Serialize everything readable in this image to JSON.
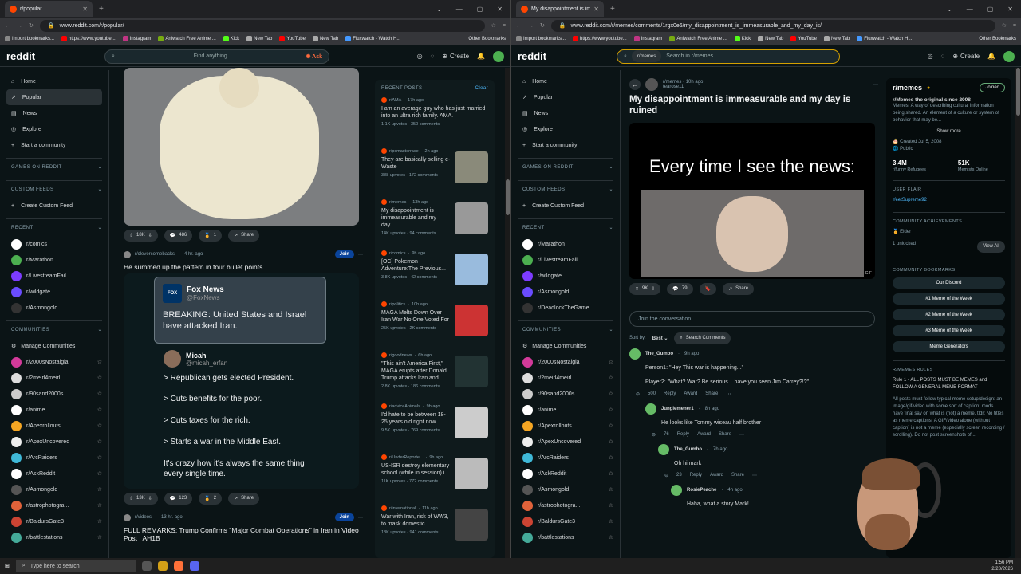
{
  "left": {
    "tab_title": "r/popular",
    "url": "www.reddit.com/r/popular/",
    "bookmarks": [
      "Import bookmarks...",
      "https://www.youtube...",
      "Instagram",
      "Aniwatch Free Anime ...",
      "Kick",
      "New Tab",
      "YouTube",
      "New Tab",
      "Fluxwatch - Watch H..."
    ],
    "other_bookmarks": "Other Bookmarks",
    "search_placeholder": "Find anything",
    "ask": "Ask",
    "create": "Create",
    "nav": [
      "Home",
      "Popular",
      "News",
      "Explore",
      "Start a community"
    ],
    "sec_games": "GAMES ON REDDIT",
    "sec_custom": "CUSTOM FEEDS",
    "create_feed": "Create Custom Feed",
    "sec_recent": "RECENT",
    "recent": [
      "r/comics",
      "r/Marathon",
      "r/LivestreamFail",
      "r/wildgate",
      "r/Asmongold"
    ],
    "sec_comm": "COMMUNITIES",
    "manage": "Manage Communities",
    "communities": [
      "r/2000sNostalgia",
      "r/2meirl4meirl",
      "r/90sand2000s...",
      "r/anime",
      "r/Apexrollouts",
      "r/ApexUncovered",
      "r/ArcRaiders",
      "r/AskReddit",
      "r/Asmongold",
      "r/astrophotogra...",
      "r/BaldursGate3",
      "r/battlestations"
    ],
    "post1": {
      "upvotes": "18K",
      "comments": "486",
      "awards": "1",
      "share": "Share"
    },
    "post2": {
      "sub": "r/clevercomebacks",
      "time": "4 hr. ago",
      "join": "Join",
      "title": "He summed up the pattern in four bullet points.",
      "fox_name": "Fox News",
      "fox_handle": "@FoxNews",
      "fox_text": "BREAKING: United States and Israel have attacked Iran.",
      "micah": "Micah",
      "micah_handle": "@micah_erfan",
      "lines": [
        "> Republican gets elected President.",
        "> Cuts benefits for the poor.",
        "> Cuts taxes for the rich.",
        "> Starts a war in the Middle East.",
        "It's crazy how it's always the same thing every single time."
      ],
      "upvotes": "13K",
      "comments": "123",
      "awards": "2",
      "share": "Share"
    },
    "post3": {
      "sub": "r/videos",
      "time": "13 hr. ago",
      "join": "Join",
      "title": "FULL REMARKS: Trump Confirms \"Major Combat Operations\" in Iran in Video Post | AH1B"
    },
    "recent_posts_header": "RECENT POSTS",
    "clear": "Clear",
    "recent_posts": [
      {
        "sub": "r/AMA",
        "time": "17h ago",
        "title": "I am an average guy who has just married into an ultra rich family. AMA.",
        "stats": "1.1K upvotes · 350 comments"
      },
      {
        "sub": "r/pcmasterrace",
        "time": "2h ago",
        "title": "They are basically selling e-Waste",
        "stats": "388 upvotes · 172 comments"
      },
      {
        "sub": "r/memes",
        "time": "13h ago",
        "title": "My disappointment is immeasurable and my day...",
        "stats": "14K upvotes · 94 comments"
      },
      {
        "sub": "r/comics",
        "time": "9h ago",
        "title": "[OC] Pokemon Adventure:The Previous...",
        "stats": "3.8K upvotes · 42 comments"
      },
      {
        "sub": "r/politics",
        "time": "10h ago",
        "title": "MAGA Melts Down Over Iran War No One Voted For",
        "stats": "25K upvotes · 2K comments"
      },
      {
        "sub": "r/goodnews",
        "time": "6h ago",
        "title": "\"This ain't America First,\" MAGA erupts after Donald Trump attacks Iran and...",
        "stats": "2.8K upvotes · 186 comments"
      },
      {
        "sub": "r/adviceAnimals",
        "time": "9h ago",
        "title": "I'd hate to be between 18-25 years old right now.",
        "stats": "9.5K upvotes · 769 comments"
      },
      {
        "sub": "r/UnderReporte...",
        "time": "9h ago",
        "title": "US-ISR destroy elementary school (while in session) i...",
        "stats": "11K upvotes · 772 comments"
      },
      {
        "sub": "r/international",
        "time": "11h ago",
        "title": "War with Iran, risk of WW3, to mask domestic...",
        "stats": "18K upvotes · 941 comments"
      }
    ]
  },
  "right": {
    "tab_title": "My disappointment is immeasu...",
    "url": "www.reddit.com/r/memes/comments/1rgx0e6/my_disappointment_is_immeasurable_and_my_day_is/",
    "search_chip": "r/memes",
    "search_placeholder": "Search in r/memes",
    "create": "Create",
    "nav": [
      "Home",
      "Popular",
      "News",
      "Explore",
      "Start a community"
    ],
    "recent": [
      "r/Marathon",
      "r/LivestreamFail",
      "r/wildgate",
      "r/Asmongold",
      "r/DeadlockTheGame"
    ],
    "communities": [
      "r/2000sNostalgia",
      "r/2meirl4meirl",
      "r/90sand2000s...",
      "r/anime",
      "r/Apexrollouts",
      "r/ApexUncovered",
      "r/ArcRaiders",
      "r/AskReddit",
      "r/Asmongold",
      "r/astrophotogra...",
      "r/BaldursGate3",
      "r/battlestations"
    ],
    "post": {
      "sub": "r/memes",
      "time": "10h ago",
      "author": "tearose11",
      "title": "My disappointment is immeasurable and my day is ruined",
      "caption": "Every time I see the news:",
      "gif": "GIF",
      "upvotes": "9K",
      "comments": "79",
      "share": "Share",
      "join_conv": "Join the conversation",
      "sort_by": "Sort by:",
      "sort_val": "Best",
      "search_comments": "Search Comments"
    },
    "comments": [
      {
        "user": "The_Gumbo",
        "time": "9h ago",
        "lines": [
          "Person1: \"Hey This war is happening...\"",
          "Player2: \"What? War? Be serious... have you seen Jim Carrey?!?\""
        ],
        "votes": "500"
      },
      {
        "user": "Junglemener1",
        "time": "8h ago",
        "lines": [
          "He looks like Tommy wiseau half brother"
        ],
        "votes": "76"
      },
      {
        "user": "The_Gumbo",
        "time": "7h ago",
        "lines": [
          "Oh hi mark"
        ],
        "votes": "23"
      },
      {
        "user": "RosiePeache",
        "time": "4h ago",
        "lines": [
          "Haha, what a story Mark!"
        ],
        "votes": ""
      }
    ],
    "comment_actions": {
      "reply": "Reply",
      "award": "Award",
      "share": "Share"
    },
    "sidebar": {
      "name": "r/memes",
      "joined": "Joined",
      "tagline": "r/Memes the original since 2008",
      "desc": "Memes! A way of describing cultural information being shared. An element of a culture or system of behavior that may be...",
      "show_more": "Show more",
      "created": "Created Jul 5, 2008",
      "public": "Public",
      "members": "3.4M",
      "members_label": "r/funny Refugees",
      "online": "51K",
      "online_label": "Memists Online",
      "user_flair": "USER FLAIR",
      "flair": "YeetSupreme92",
      "achievements": "COMMUNITY ACHIEVEMENTS",
      "elder": "Elder",
      "unlocked": "1 unlocked",
      "view_all": "View All",
      "bookmarks_h": "COMMUNITY BOOKMARKS",
      "bookmarks": [
        "Our Discord",
        "#1 Meme of the Week",
        "#2 Meme of the Week",
        "#3 Meme of the Week",
        "Meme Generators"
      ],
      "rules_h": "R/MEMES RULES",
      "rule1": "Rule 1 - ALL POSTS MUST BE MEMES and FOLLOW A GENERAL MEME FORMAT",
      "rule_text": "All posts must follow typical meme setup/design: an image/gif/video with some sort of caption; mods have final say on what is (not) a meme. tldr: No titles as meme captions. A GIF/video alone (without caption) is not a meme (especially screen recording / scrolling). Do not post screenshots of ..."
    }
  },
  "taskbar": {
    "search": "Type here to search",
    "time": "1:56 PM",
    "date": "2/28/2026"
  }
}
